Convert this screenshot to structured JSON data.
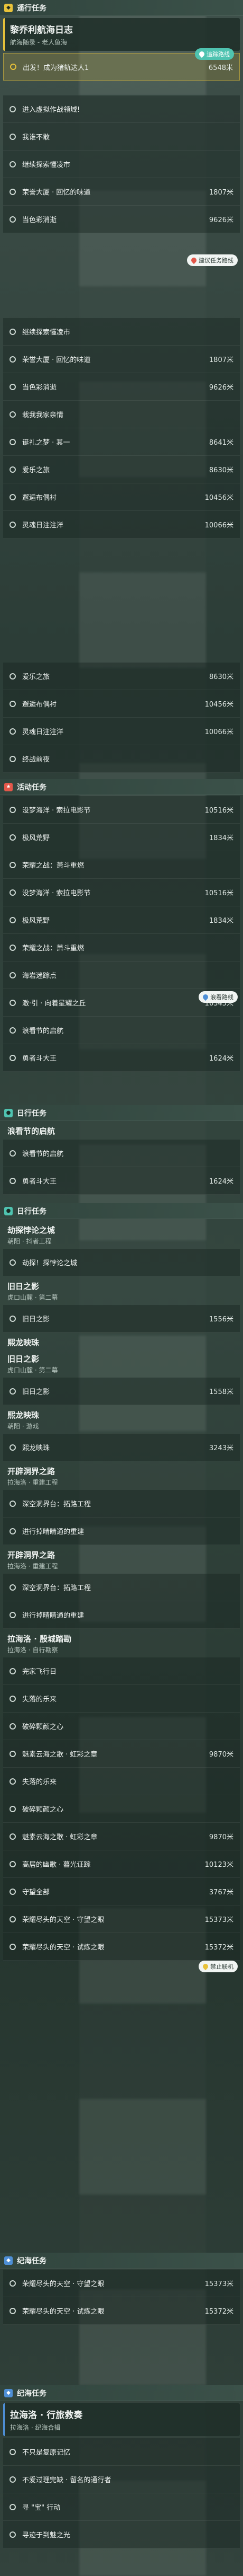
{
  "colors": {
    "accent": "#e8c23a",
    "teal": "#4fc3b0",
    "red": "#e3574a",
    "blue": "#4e8fd6"
  },
  "main_quest": {
    "header": "遥行任务",
    "title": "黎乔利航海日志",
    "subtitle": "航海随录 - 老人鱼海",
    "current_step": "出发！成为猪轨达人1",
    "current_dist": "6548米",
    "current_tag": "追踪路线"
  },
  "list1": [
    {
      "text": "进入虚拟作战领域!",
      "dist": ""
    },
    {
      "text": "我谁不敢",
      "dist": ""
    },
    {
      "text": "继续探索懂凌市",
      "dist": ""
    },
    {
      "text": "荣誉大厦 · 回忆的味道",
      "dist": "1807米"
    },
    {
      "text": "当色彩消逝",
      "dist": "9626米"
    }
  ],
  "tag_chinese": "建议任务路线",
  "list2": [
    {
      "text": "继续探索懂凌市",
      "dist": ""
    },
    {
      "text": "荣誉大厦 · 回忆的味道",
      "dist": "1807米"
    },
    {
      "text": "当色彩消逝",
      "dist": "9626米"
    },
    {
      "text": "栽我我家亲情",
      "dist": ""
    },
    {
      "text": "诞礼之梦 · 其一",
      "dist": "8641米"
    },
    {
      "text": "爱乐之旅",
      "dist": "8630米"
    },
    {
      "text": "邂逅布偶衬",
      "dist": "10456米"
    },
    {
      "text": "灵魂日注注洋",
      "dist": "10066米"
    }
  ],
  "list3": [
    {
      "text": "爱乐之旅",
      "dist": "8630米"
    },
    {
      "text": "邂逅布偶衬",
      "dist": "10456米"
    },
    {
      "text": "灵魂日注注洋",
      "dist": "10066米"
    },
    {
      "text": "终战前夜",
      "dist": ""
    }
  ],
  "event_section": "活动任务",
  "event_list": [
    {
      "text": "没梦海洋 · 索拉电影节",
      "dist": "10516米"
    },
    {
      "text": "极风荒野",
      "dist": "1834米"
    },
    {
      "text": "荣耀之战：萧斗重燃",
      "dist": ""
    },
    {
      "text": "没梦海洋 · 索拉电影节",
      "dist": "10516米"
    },
    {
      "text": "极风荒野",
      "dist": "1834米"
    },
    {
      "text": "荣耀之战：萧斗重燃",
      "dist": ""
    },
    {
      "text": "海岩迷踪点",
      "dist": ""
    },
    {
      "text": "激·引 · 向着星耀之丘",
      "dist": "16345米"
    },
    {
      "text": "浪看节的启航",
      "dist": ""
    },
    {
      "text": "勇者斗大王",
      "dist": "1624米"
    }
  ],
  "tag_event": "浪看路线",
  "daily_section": "日行任务",
  "daily_quest_title": "浪看节的启航",
  "daily_list": [
    {
      "text": "浪看节的启航",
      "dist": ""
    },
    {
      "text": "勇者斗大王",
      "dist": "1624米"
    }
  ],
  "daily_section2": "日行任务",
  "groups": [
    {
      "title": "劫探悖论之城",
      "sub": "朝阳 · 抖者工程",
      "items": [
        {
          "text": "劫探！探悖论之城",
          "dist": ""
        }
      ]
    },
    {
      "title": "旧日之影",
      "sub": "虎口山麓 · 第二幕",
      "items": [
        {
          "text": "旧日之影",
          "dist": "1556米"
        }
      ]
    },
    {
      "title": "熙龙映珠",
      "sub": "",
      "items": []
    },
    {
      "title": "旧日之影",
      "sub": "虎口山麓 · 第二幕",
      "items": [
        {
          "text": "旧日之影",
          "dist": "1558米"
        }
      ]
    },
    {
      "title": "熙龙映珠",
      "sub": "朝阳 · 游戏",
      "items": [
        {
          "text": "熙龙映珠",
          "dist": "3243米"
        }
      ]
    },
    {
      "title": "开辟洞界之路",
      "sub": "拉海洛 · 重建工程",
      "items": [
        {
          "text": "深空洞界台：拓路工程",
          "dist": ""
        },
        {
          "text": "进行掉晴睛通的重建",
          "dist": ""
        }
      ]
    },
    {
      "title": "开辟洞界之路",
      "sub": "拉海洛 · 重建工程",
      "items": [
        {
          "text": "深空洞界台：拓路工程",
          "dist": ""
        },
        {
          "text": "进行掉晴睛通的重建",
          "dist": ""
        }
      ]
    },
    {
      "title": "拉海洛 · 殷城踏勘",
      "sub": "拉海洛 · 自行勘察",
      "items": [
        {
          "text": "完家飞行日",
          "dist": ""
        },
        {
          "text": "失落的乐来",
          "dist": ""
        },
        {
          "text": "破碎颗颜之心",
          "dist": ""
        },
        {
          "text": "魅素云海之歌 · 虹彩之章",
          "dist": "9870米"
        },
        {
          "text": "失落的乐来",
          "dist": ""
        },
        {
          "text": "破碎颗颜之心",
          "dist": ""
        },
        {
          "text": "魅素云海之歌 · 虹彩之章",
          "dist": "9870米"
        },
        {
          "text": "高居的幽歌 · 暮光证踪",
          "dist": "10123米"
        },
        {
          "text": "守望全部",
          "dist": "3767米"
        },
        {
          "text": "荣耀尽头的天空 · 守望之眼",
          "dist": "15373米"
        },
        {
          "text": "荣耀尽头的天空 · 试炼之眼",
          "dist": "15372米"
        }
      ]
    }
  ],
  "tag_group": "禁止联机",
  "sec_final": "纪海任务",
  "final_list": [
    {
      "text": "荣耀尽头的天空 · 守望之眼",
      "dist": "15373米"
    },
    {
      "text": "荣耀尽头的天空 · 试炼之眼",
      "dist": "15372米"
    }
  ],
  "sec_last": "纪海任务",
  "last_quest": {
    "title": "拉海洛 · 行旅救奏",
    "sub": "拉海洛 · 纪海合辑"
  },
  "last_list": [
    {
      "text": "不只是复原记忆",
      "dist": ""
    },
    {
      "text": "不爱过理完缺 · 留名的通行者",
      "dist": ""
    },
    {
      "text": "寻 \"宝\" 行动",
      "dist": ""
    },
    {
      "text": "寻迹于到魅之光",
      "dist": ""
    }
  ]
}
